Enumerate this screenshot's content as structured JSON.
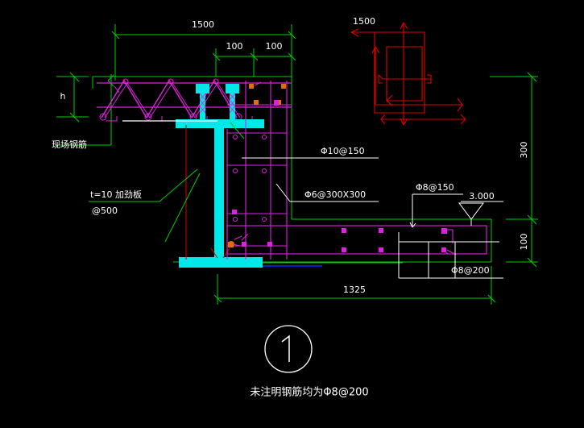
{
  "drawing": {
    "title_marker": "1",
    "note": "未注明钢筋均为Φ8@200",
    "background_color": "#000000"
  },
  "colors": {
    "dimension_green": "#00d000",
    "rebar_magenta": "#e020e0",
    "steel_cyan": "#00e8e8",
    "detail_red": "#e00000",
    "leader_white": "#ffffff",
    "blue_line": "#0030ff",
    "node_orange": "#e07000"
  },
  "dimensions": {
    "top_overall": "1500",
    "top_seg_left": "100",
    "top_seg_right": "100",
    "left_height": "h",
    "right_upper": "300",
    "right_lower": "100",
    "bottom_overall": "1325",
    "detail_width": "1500"
  },
  "labels": {
    "site_rebar": "现场钢筋",
    "stiffener_line1": "t=10  加劲板",
    "stiffener_line2": "@500",
    "slab_top_rebar": "Φ10@150",
    "tie_rebar": "Φ6@300X300",
    "stirrup_rebar": "Φ8@150",
    "bottom_rebar": "Φ8@200",
    "level_mark": "3.000"
  }
}
